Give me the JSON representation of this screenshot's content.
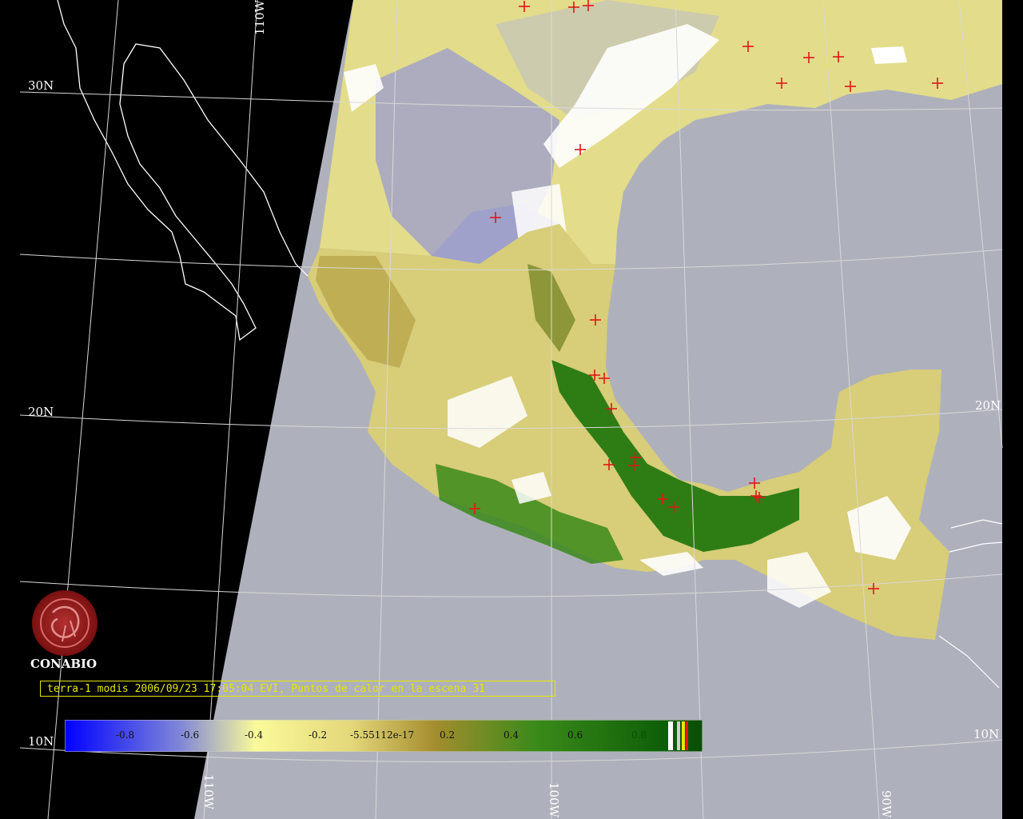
{
  "labels": {
    "lon_110_top": "110W",
    "lat_30": "30N",
    "lat_20_left": "20N",
    "lat_20_right": "20N",
    "lat_10_left": "10N",
    "lat_10_right": "10N",
    "lon_110_bottom": "110W",
    "lon_100_bottom": "100W",
    "lon_90_bottom": "90W"
  },
  "brand": "CONABIO",
  "caption": "terra-1 modis 2006/09/23 17:05:04 EVI, Puntos de calor en la escena 31",
  "colorbar": {
    "ticks": [
      "-0.8",
      "-0.6",
      "-0.4",
      "-0.2",
      "-5.55112e-17",
      "0.2",
      "0.4",
      "0.6",
      "0.8"
    ]
  },
  "colors": {
    "background": "#000000",
    "ocean": "#aeb1bb",
    "land_yellow": "#e6df8c",
    "land_green": "#2e7d14",
    "land_blue": "#8d92c9",
    "cloud": "#ffffff",
    "hotspot": "#e01818",
    "caption": "#e6e600",
    "logo": "#8b1a1a"
  }
}
